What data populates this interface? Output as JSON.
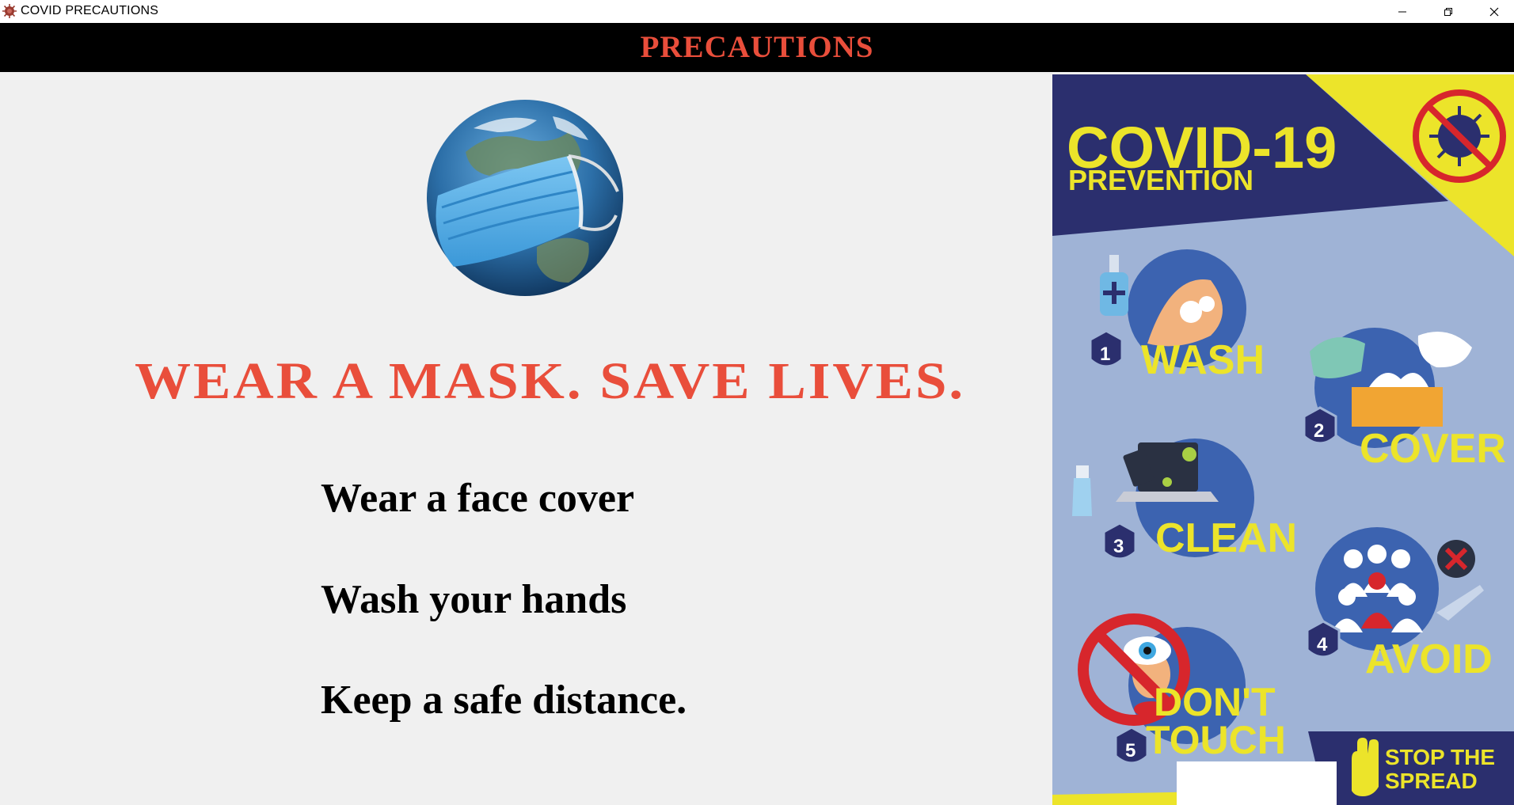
{
  "window": {
    "title": "COVID PRECAUTIONS",
    "controls": [
      "minimize",
      "restore",
      "close"
    ]
  },
  "header": {
    "title": "PRECAUTIONS"
  },
  "main": {
    "slogan": "WEAR A MASK. SAVE LIVES.",
    "tips": [
      "Wear a face cover",
      "Wash your hands",
      "Keep a safe distance."
    ],
    "illustration": "globe-with-face-mask"
  },
  "poster": {
    "title": "COVID-19",
    "subtitle": "PREVENTION",
    "steps": [
      {
        "number": "1",
        "label": "WASH"
      },
      {
        "number": "2",
        "label": "COVER"
      },
      {
        "number": "3",
        "label": "CLEAN"
      },
      {
        "number": "4",
        "label": "AVOID"
      },
      {
        "number": "5",
        "label_line1": "DON'T",
        "label_line2": "TOUCH"
      }
    ],
    "footer_line1": "STOP THE",
    "footer_line2": "SPREAD"
  },
  "colors": {
    "accent_red": "#e94e3b",
    "poster_navy": "#2b2f6e",
    "poster_yellow": "#ece42a",
    "poster_bg": "#9fb3d6",
    "circle_blue": "#3c63b0"
  }
}
